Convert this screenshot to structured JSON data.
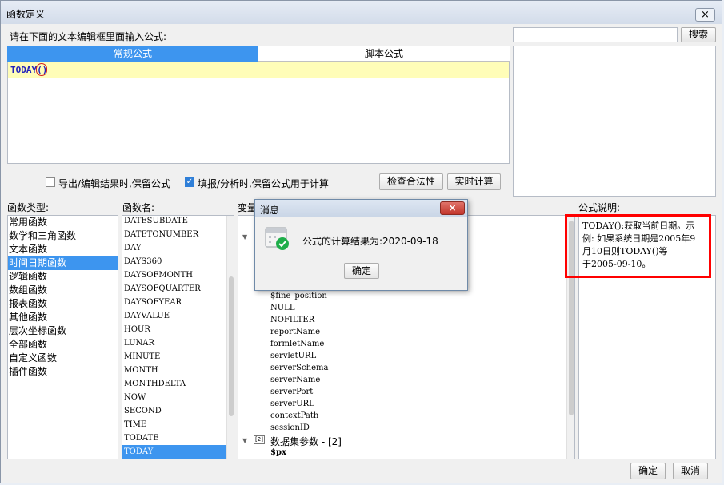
{
  "window": {
    "title": "函数定义",
    "close_icon": "×"
  },
  "editor": {
    "prompt": "请在下面的文本编辑框里面输入公式:",
    "tabs": [
      "常规公式",
      "脚本公式"
    ],
    "formula_name": "TODAY",
    "formula_paren": "()"
  },
  "search": {
    "button": "搜索",
    "value": ""
  },
  "options": {
    "export_label": "导出/编辑结果时,保留公式",
    "export_checked": false,
    "fill_label": "填报/分析时,保留公式用于计算",
    "fill_checked": true,
    "check_button": "检查合法性",
    "realtime_button": "实时计算"
  },
  "categories": {
    "label": "函数类型:",
    "items": [
      "常用函数",
      "数学和三角函数",
      "文本函数",
      "时间日期函数",
      "逻辑函数",
      "数组函数",
      "报表函数",
      "其他函数",
      "层次坐标函数",
      "全部函数",
      "自定义函数",
      "插件函数"
    ],
    "selected_index": 3
  },
  "functions": {
    "label": "函数名:",
    "items": [
      "DATESUBDATE",
      "DATETONUMBER",
      "DAY",
      "DAYS360",
      "DAYSOFMONTH",
      "DAYSOFQUARTER",
      "DAYSOFYEAR",
      "DAYVALUE",
      "HOUR",
      "LUNAR",
      "MINUTE",
      "MONTH",
      "MONTHDELTA",
      "NOW",
      "SECOND",
      "TIME",
      "TODATE",
      "TODAY"
    ],
    "selected_index": 17
  },
  "variables": {
    "label": "变量",
    "items": [
      "$fine_position",
      "NULL",
      "NOFILTER",
      "reportName",
      "formletName",
      "servletURL",
      "serverSchema",
      "serverName",
      "serverPort",
      "serverURL",
      "contextPath",
      "sessionID"
    ],
    "group_label": "数据集参数 - [2]",
    "group_child": "$px"
  },
  "description": {
    "label": "公式说明:",
    "lines": [
      "TODAY():获取当前日期。示",
      "例: 如果系统日期是2005年9",
      "月10日则TODAY()等",
      "于2005-09-10。"
    ]
  },
  "dialog": {
    "title": "消息",
    "message": "公式的计算结果为:2020-09-18",
    "ok_button": "确定",
    "close_icon": "×",
    "icon": "success-calendar-icon"
  },
  "footer": {
    "ok": "确定",
    "cancel": "取消"
  },
  "colors": {
    "accent": "#3d95ef",
    "highlight_border": "#ff0000",
    "editor_line": "#fffdb8",
    "success": "#1fae4a"
  }
}
